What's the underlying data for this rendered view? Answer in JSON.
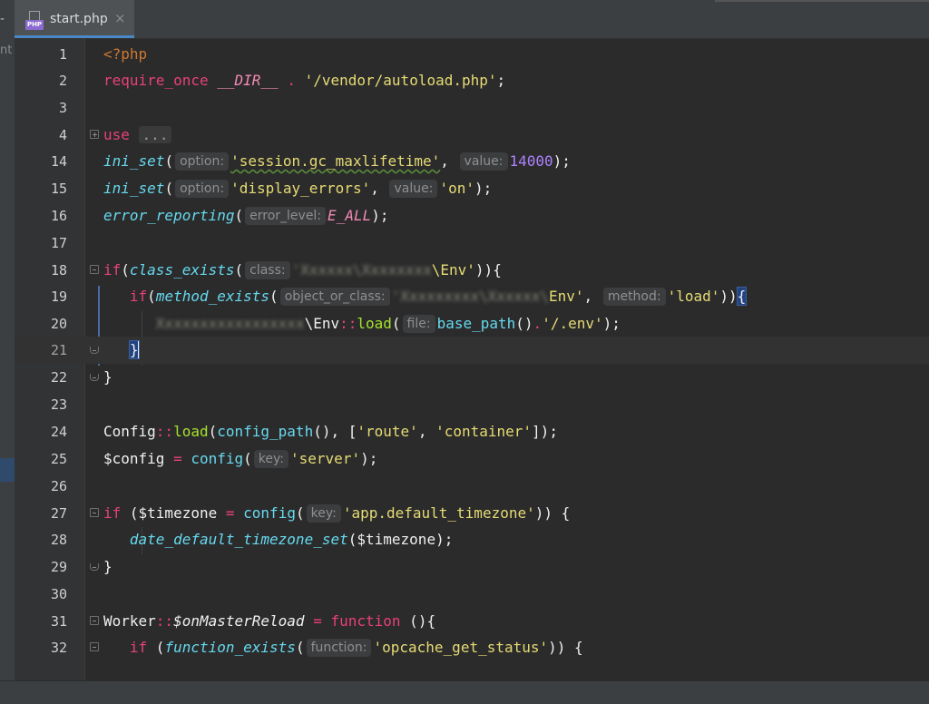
{
  "tab": {
    "icon_badge": "PHP",
    "filename": "start.php",
    "close_glyph": "×"
  },
  "left_panel": {
    "dash": "-",
    "clipped_text": "nt"
  },
  "line_numbers": [
    "1",
    "2",
    "3",
    "4",
    "14",
    "15",
    "16",
    "17",
    "18",
    "19",
    "20",
    "21",
    "22",
    "23",
    "24",
    "25",
    "26",
    "27",
    "28",
    "29",
    "30",
    "31",
    "32"
  ],
  "code": {
    "l1_tag": "<?php",
    "l2_kw": "require_once",
    "l2_const": "__DIR__",
    "l2_op": ".",
    "l2_str": "'/vendor/autoload.php'",
    "l2_end": ";",
    "l4_kw": "use",
    "l4_fold": "...",
    "l14_fn": "ini_set",
    "l14_hint1": "option:",
    "l14_str1": "'session.gc_maxlifetime'",
    "l14_hint2": "value:",
    "l14_num": "14000",
    "l15_fn": "ini_set",
    "l15_hint1": "option:",
    "l15_str1": "'display_errors'",
    "l15_hint2": "value:",
    "l15_str2": "'on'",
    "l16_fn": "error_reporting",
    "l16_hint": "error_level:",
    "l16_const": "E_ALL",
    "l18_kw": "if",
    "l18_fn": "class_exists",
    "l18_hint": "class:",
    "l18_str_tail": "\\Env'",
    "l19_kw": "if",
    "l19_fn": "method_exists",
    "l19_hint1": "object_or_class:",
    "l19_str_tail": "Env'",
    "l19_hint2": "method:",
    "l19_str2": "'load'",
    "l20_class_tail": "\\Env",
    "l20_method": "load",
    "l20_hint": "file:",
    "l20_fn": "base_path",
    "l20_str": "'/.env'",
    "l24_class": "Config",
    "l24_method": "load",
    "l24_fn": "config_path",
    "l24_str1": "'route'",
    "l24_str2": "'container'",
    "l25_var": "$config",
    "l25_fn": "config",
    "l25_hint": "key:",
    "l25_str": "'server'",
    "l27_kw": "if",
    "l27_var": "$timezone",
    "l27_fn": "config",
    "l27_hint": "key:",
    "l27_str": "'app.default_timezone'",
    "l28_fn": "date_default_timezone_set",
    "l28_var": "$timezone",
    "l31_class": "Worker",
    "l31_prop": "$onMasterReload",
    "l31_kw": "function",
    "l32_kw": "if",
    "l32_fn": "function_exists",
    "l32_hint": "function:",
    "l32_str": "'opcache_get_status'"
  },
  "colors": {
    "keyword": "#e8407a",
    "string": "#e6db74",
    "number": "#ae81ff",
    "function": "#66d9ef",
    "method": "#a6e22e",
    "php_tag": "#cc7832",
    "background": "#2b2b2b"
  }
}
